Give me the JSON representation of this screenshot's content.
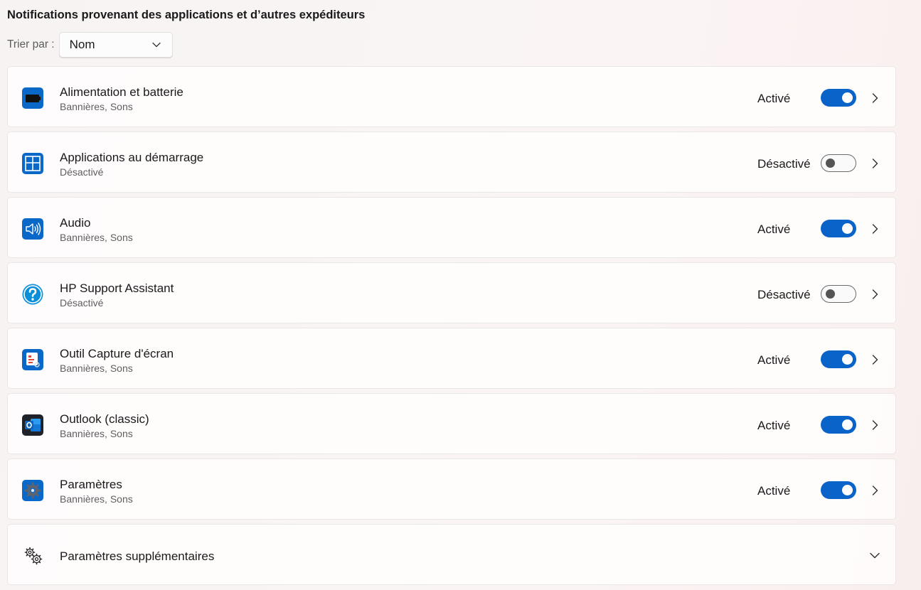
{
  "section": {
    "title": "Notifications provenant des applications et d’autres expéditeurs"
  },
  "sort": {
    "label": "Trier par :",
    "value": "Nom"
  },
  "apps": [
    {
      "name": "Alimentation et batterie",
      "subtitle": "Bannières, Sons",
      "state": "Activé",
      "on": true,
      "icon": "battery-icon"
    },
    {
      "name": "Applications au démarrage",
      "subtitle": "Désactivé",
      "state": "Désactivé",
      "on": false,
      "icon": "startup-apps-icon"
    },
    {
      "name": "Audio",
      "subtitle": "Bannières, Sons",
      "state": "Activé",
      "on": true,
      "icon": "speaker-icon"
    },
    {
      "name": "HP Support Assistant",
      "subtitle": "Désactivé",
      "state": "Désactivé",
      "on": false,
      "icon": "help-question-icon"
    },
    {
      "name": "Outil Capture d'écran",
      "subtitle": "Bannières, Sons",
      "state": "Activé",
      "on": true,
      "icon": "snipping-tool-icon"
    },
    {
      "name": "Outlook (classic)",
      "subtitle": "Bannières, Sons",
      "state": "Activé",
      "on": true,
      "icon": "outlook-icon"
    },
    {
      "name": "Paramètres",
      "subtitle": "Bannières, Sons",
      "state": "Activé",
      "on": true,
      "icon": "settings-gear-icon"
    }
  ],
  "additional": {
    "label": "Paramètres supplémentaires",
    "icon": "gears-icon"
  },
  "colors": {
    "accent": "#0a63c9",
    "toggle_off_knob": "#555555"
  }
}
